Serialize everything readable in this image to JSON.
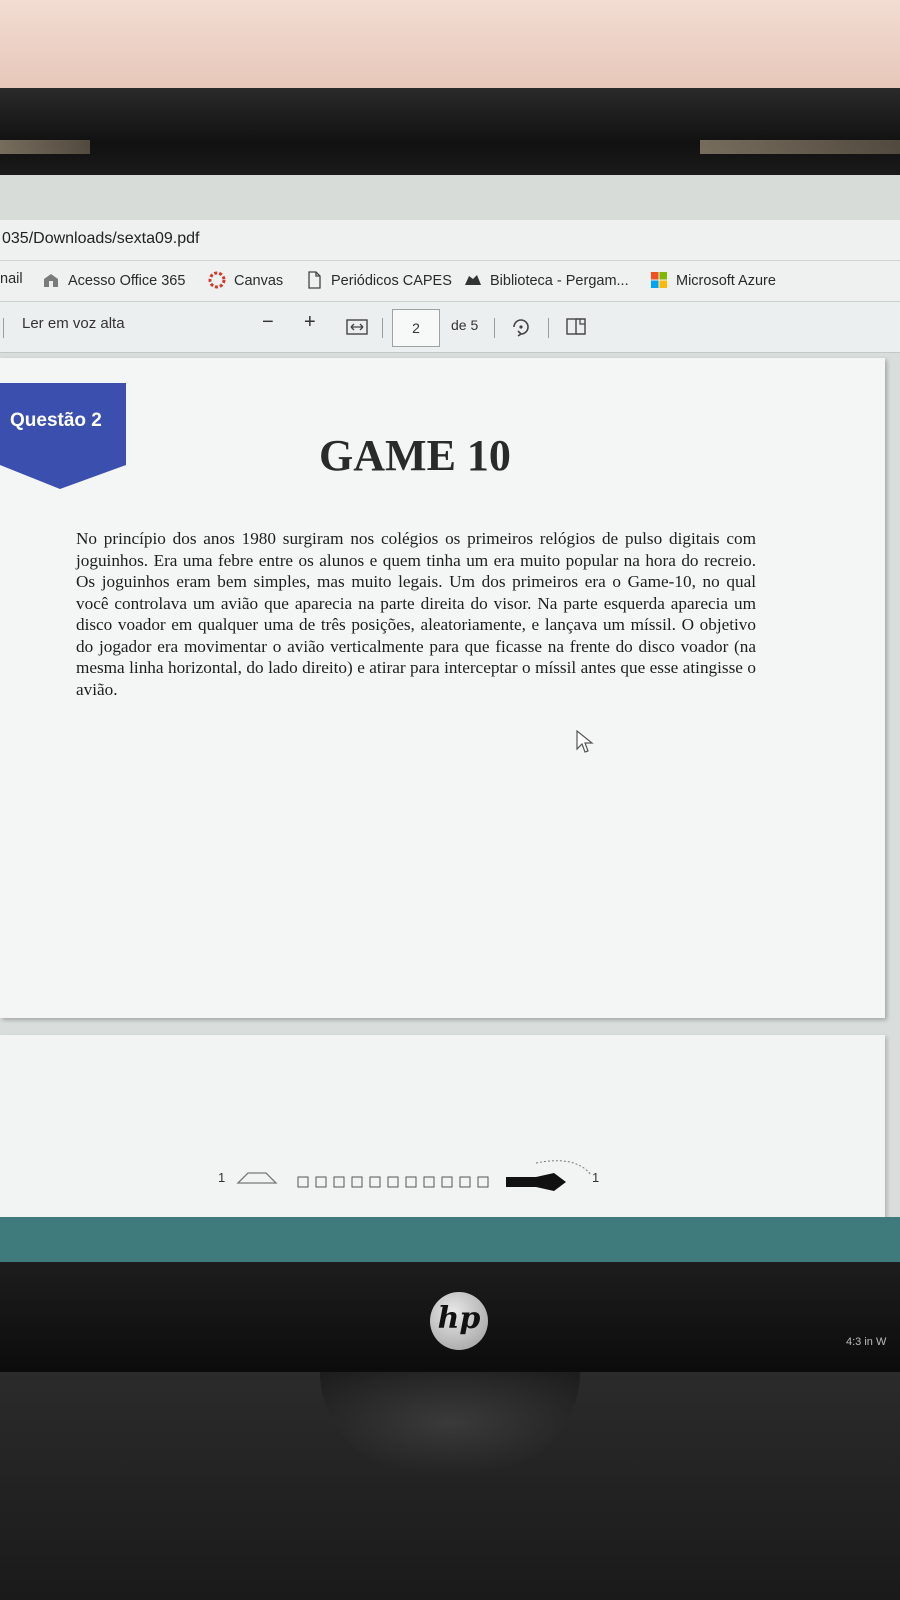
{
  "browser": {
    "address": "035/Downloads/sexta09.pdf",
    "bookmarks": [
      "nail",
      "Acesso Office 365",
      "Canvas",
      "Periódicos CAPES",
      "Biblioteca - Pergam...",
      "Microsoft Azure"
    ]
  },
  "pdf_toolbar": {
    "read_aloud": "Ler em voz alta",
    "zoom_out": "−",
    "zoom_in": "+",
    "current_page": "2",
    "page_total": "de 5"
  },
  "document": {
    "badge": "Questão 2",
    "title": "GAME 10",
    "paragraph": "No princípio dos anos 1980 surgiram nos colégios os primeiros relógios de pulso digitais com joguinhos. Era uma febre entre os alunos e quem tinha um era muito popular na hora do recreio. Os joguinhos eram bem simples, mas muito legais. Um dos primeiros era o Game-10, no qual você controlava um avião que aparecia na parte direita do visor. Na parte esquerda aparecia um disco voador em qualquer uma de três posições, aleatoriamente, e lançava um míssil. O objetivo do jogador era movimentar o avião verticalmente para que ficasse na frente do disco voador (na mesma linha horizontal, do lado direito) e atirar para interceptar o míssil antes que esse atingisse o avião.",
    "next_page_left_digit": "1",
    "next_page_right_digit": "1"
  },
  "monitor": {
    "brand": "hp",
    "sticker": "4:3 in W"
  },
  "colors": {
    "badge": "#3a4fae",
    "taskbar": "#3f7a7c"
  }
}
